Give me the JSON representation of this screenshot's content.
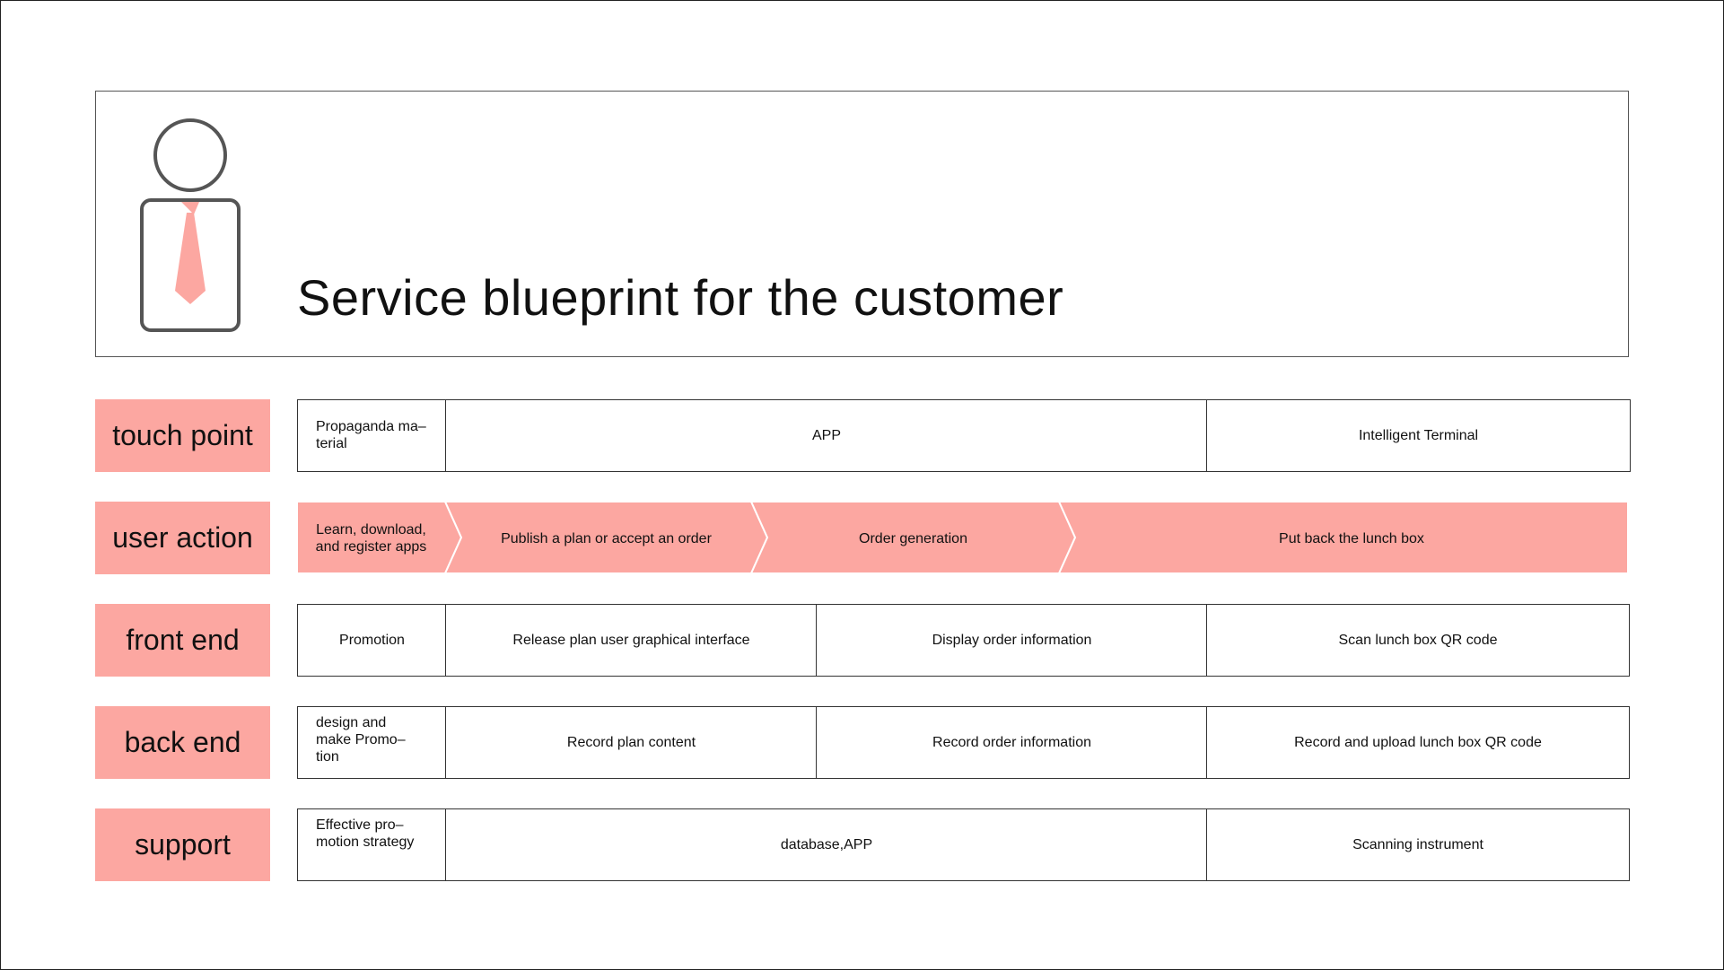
{
  "title": "Service blueprint for the customer",
  "colors": {
    "accent": "#fca7a1",
    "border": "#333333"
  },
  "icons": {
    "person": "person-with-tie-icon"
  },
  "rows": {
    "touch_point": {
      "label": "touch point",
      "cells": [
        "Propaganda ma–\nterial",
        "APP",
        "Intelligent Terminal"
      ]
    },
    "user_action": {
      "label": "user action",
      "cells": [
        "Learn, download,\nand register apps",
        "Publish a plan or accept an order",
        "Order generation",
        "Put back the lunch box"
      ]
    },
    "front_end": {
      "label": "front end",
      "cells": [
        "Promotion",
        "Release plan user graphical interface",
        "Display order information",
        "Scan lunch box QR code"
      ]
    },
    "back_end": {
      "label": "back end",
      "cells": [
        "design and\nmake Promo–\ntion",
        "Record plan content",
        "Record order information",
        "Record and upload lunch box QR code"
      ]
    },
    "support": {
      "label": "support",
      "cells": [
        "Effective pro–\nmotion strategy",
        "database,APP",
        "Scanning instrument"
      ]
    }
  }
}
